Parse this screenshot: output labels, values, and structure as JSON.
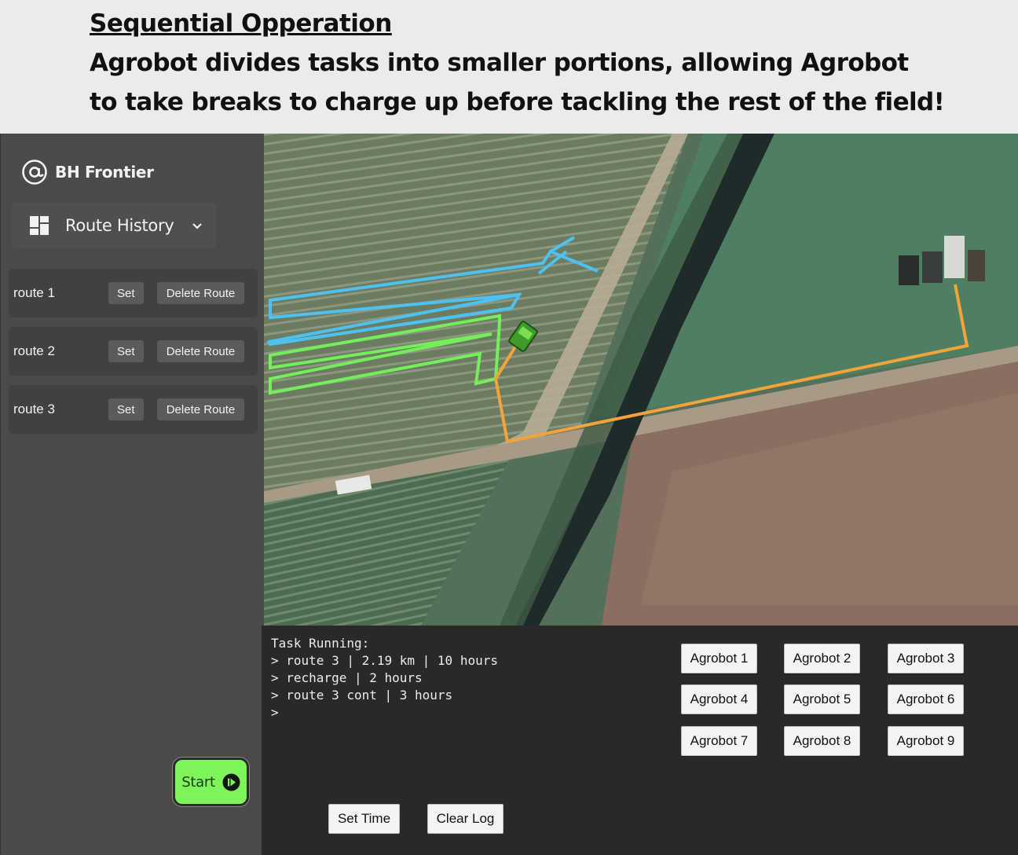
{
  "caption": {
    "title": "Sequential Opperation",
    "line1": "Agrobot divides tasks into smaller portions, allowing Agrobot",
    "line2": "to take breaks to charge up before tackling the rest of the field!"
  },
  "sidebar": {
    "brand": "BH Frontier",
    "menu_label": "Route History",
    "routes": [
      {
        "name": "route 1",
        "set_label": "Set",
        "delete_label": "Delete Route"
      },
      {
        "name": "route 2",
        "set_label": "Set",
        "delete_label": "Delete Route"
      },
      {
        "name": "route 3",
        "set_label": "Set",
        "delete_label": "Delete Route"
      }
    ],
    "start_label": "Start"
  },
  "map": {
    "route_colors": {
      "route_1": "#4fc1f0",
      "route_2": "#74ee5a",
      "route_3": "#f2a43a"
    }
  },
  "console": {
    "log_lines": [
      "Task Running:",
      "> route 3 | 2.19 km | 10 hours",
      "> recharge | 2 hours",
      "> route 3 cont | 3 hours",
      ">"
    ],
    "agrobots": [
      "Agrobot 1",
      "Agrobot 2",
      "Agrobot 3",
      "Agrobot 4",
      "Agrobot 5",
      "Agrobot 6",
      "Agrobot 7",
      "Agrobot 8",
      "Agrobot 9"
    ],
    "set_time_label": "Set Time",
    "clear_log_label": "Clear Log"
  },
  "icons": [
    "at-sign-icon",
    "dashboard-icon",
    "chevron-down-icon",
    "play-icon"
  ]
}
